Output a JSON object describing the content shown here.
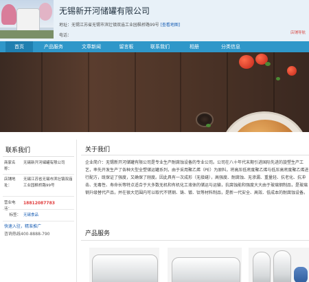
{
  "header": {
    "company_name": "无锡新开河储罐有限公司",
    "address_label": "地址：",
    "address_value": "无锡江苏省无锡市滨壮镇双庙工业园枫桥路99号",
    "map_link": "[查看地图]",
    "phone_label": "电话：",
    "switch_link": "店铺导航"
  },
  "nav": {
    "items": [
      "首页",
      "产品服务",
      "文章新闻",
      "留言板",
      "联系我们",
      "相册",
      "分类信息"
    ],
    "active_index": 0
  },
  "contact": {
    "title": "联系我们",
    "company_label": "商家名称：",
    "company_value": "无锡新开河储罐有限公司",
    "address_label": "店铺地址：",
    "address_value": "无锡江苏省无锡市滨壮镇双庙工业园枫桥路99号",
    "phone_label": "营业电话：",
    "phone_value": "18812087783",
    "tag_label": "标签：",
    "tag_value": "无锡食品",
    "quick_link": "快速入驻，精准推广",
    "hotline": "咨询热线400-8888-790"
  },
  "about": {
    "title": "关于我们",
    "text": "企业简介：无锡新开河储罐有限公司是专业生产耐腐蚀设备的专业公司。公司在八十年代末期引进国际先进的旋塑生产工艺，率先开发生产了各种大型全塑储运罐系列，由于采用聚乙烯（PE）为原料，将高压低密度聚乙烯与低压高密度聚乙烯进行配方，既保证了强度，又确保了刚度。因此具有一次成形（无接缝），高强度、耐腐蚀、无渗漏、重量轻、抗老化、抗冲击、无毒性、寿命长等特点适合于大多数无机和有机化工液体的储运与运输，抗腐蚀能和强度大大由于玻璃钢制品，是玻璃钢升级替代产品，并在很大范围内可以取代不锈钢、铸、镀、钛等材料制品，是新一代安全、高效、低成本的耐腐蚀设备。"
  },
  "products": {
    "title": "产品服务"
  },
  "colors": {
    "nav_bg": "#2f97c9",
    "header_bg": "#e8f1f8",
    "phone_red": "#e03a3a",
    "link_blue": "#1a5fb4"
  }
}
